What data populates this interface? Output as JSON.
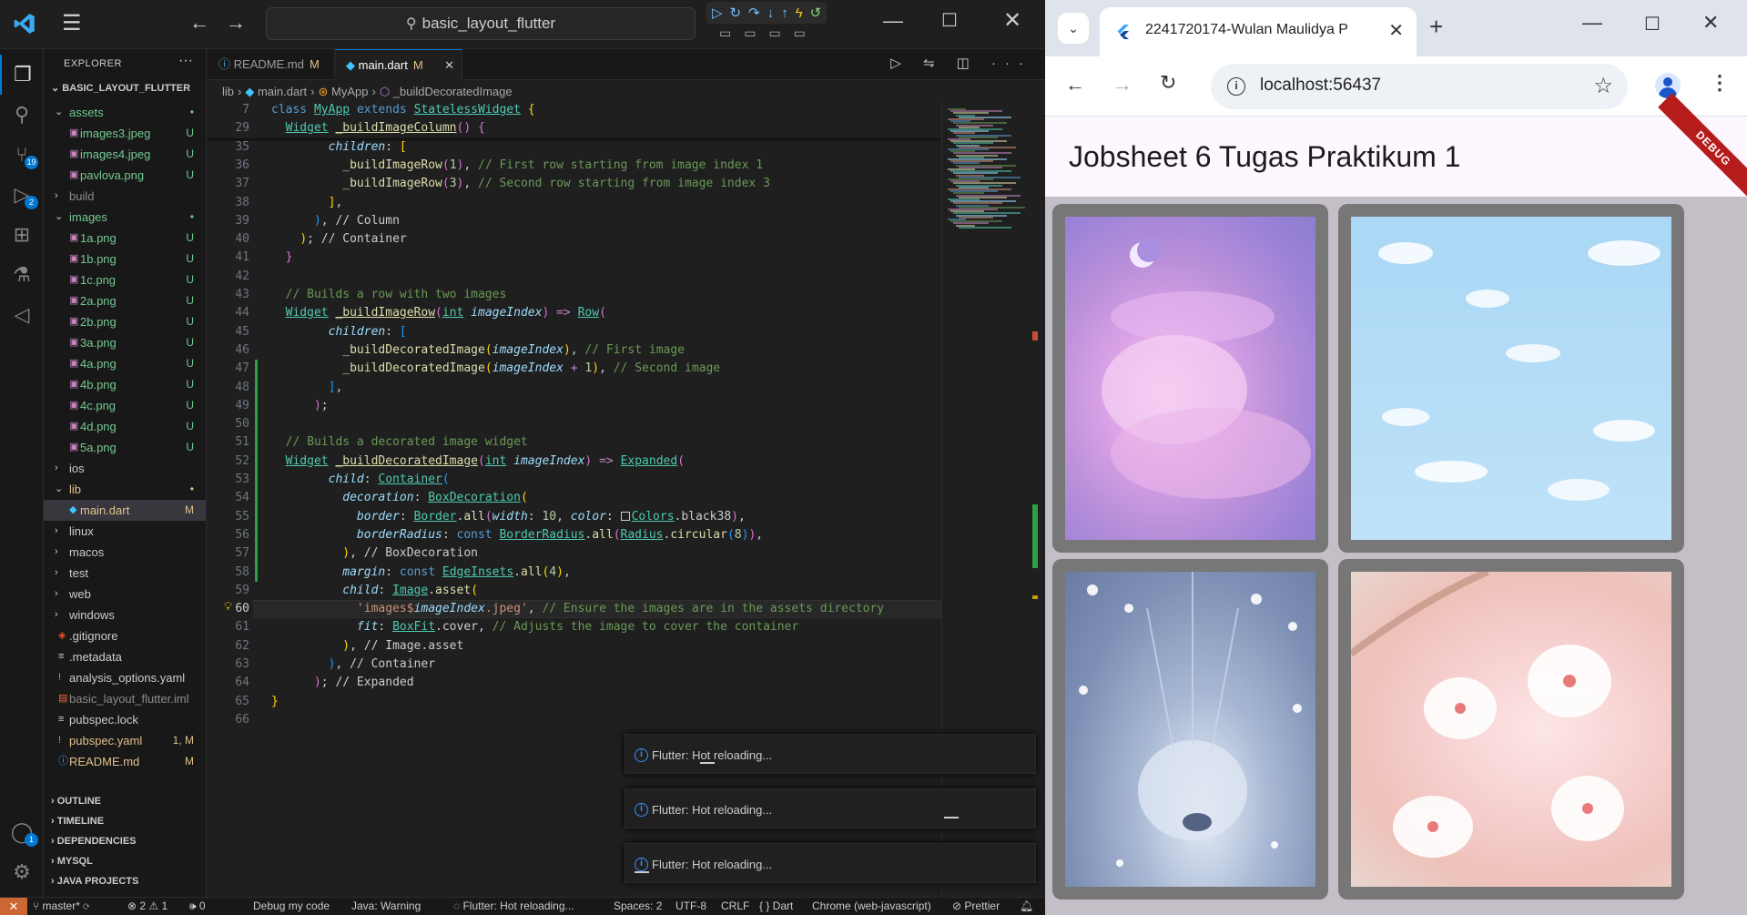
{
  "vscode": {
    "project_name": "basic_layout_flutter",
    "explorer": {
      "title": "EXPLORER",
      "more": "···",
      "project_title": "BASIC_LAYOUT_FLUTTER",
      "tree": [
        {
          "name": "assets",
          "kind": "folder",
          "depth": 0,
          "status": "•",
          "color": "#73c991"
        },
        {
          "name": "images3.jpeg",
          "kind": "image",
          "depth": 1,
          "status": "U",
          "color": "#73c991"
        },
        {
          "name": "images4.jpeg",
          "kind": "image",
          "depth": 1,
          "status": "U",
          "color": "#73c991"
        },
        {
          "name": "pavlova.png",
          "kind": "image",
          "depth": 1,
          "status": "U",
          "color": "#73c991"
        },
        {
          "name": "build",
          "kind": "folder-closed",
          "depth": 0,
          "status": "",
          "color": "#8c8c8c"
        },
        {
          "name": "images",
          "kind": "folder",
          "depth": 0,
          "status": "•",
          "color": "#73c991"
        },
        {
          "name": "1a.png",
          "kind": "image",
          "depth": 1,
          "status": "U",
          "color": "#73c991"
        },
        {
          "name": "1b.png",
          "kind": "image",
          "depth": 1,
          "status": "U",
          "color": "#73c991"
        },
        {
          "name": "1c.png",
          "kind": "image",
          "depth": 1,
          "status": "U",
          "color": "#73c991"
        },
        {
          "name": "2a.png",
          "kind": "image",
          "depth": 1,
          "status": "U",
          "color": "#73c991"
        },
        {
          "name": "2b.png",
          "kind": "image",
          "depth": 1,
          "status": "U",
          "color": "#73c991"
        },
        {
          "name": "3a.png",
          "kind": "image",
          "depth": 1,
          "status": "U",
          "color": "#73c991"
        },
        {
          "name": "4a.png",
          "kind": "image",
          "depth": 1,
          "status": "U",
          "color": "#73c991"
        },
        {
          "name": "4b.png",
          "kind": "image",
          "depth": 1,
          "status": "U",
          "color": "#73c991"
        },
        {
          "name": "4c.png",
          "kind": "image",
          "depth": 1,
          "status": "U",
          "color": "#73c991"
        },
        {
          "name": "4d.png",
          "kind": "image",
          "depth": 1,
          "status": "U",
          "color": "#73c991"
        },
        {
          "name": "5a.png",
          "kind": "image",
          "depth": 1,
          "status": "U",
          "color": "#73c991"
        },
        {
          "name": "ios",
          "kind": "folder-closed",
          "depth": 0,
          "status": "",
          "color": "#cccccc"
        },
        {
          "name": "lib",
          "kind": "folder",
          "depth": 0,
          "status": "•",
          "color": "#e2c08d"
        },
        {
          "name": "main.dart",
          "kind": "dart",
          "depth": 1,
          "status": "M",
          "color": "#e2c08d",
          "selected": true
        },
        {
          "name": "linux",
          "kind": "folder-closed",
          "depth": 0,
          "status": "",
          "color": "#cccccc"
        },
        {
          "name": "macos",
          "kind": "folder-closed",
          "depth": 0,
          "status": "",
          "color": "#cccccc"
        },
        {
          "name": "test",
          "kind": "folder-closed",
          "depth": 0,
          "status": "",
          "color": "#cccccc"
        },
        {
          "name": "web",
          "kind": "folder-closed",
          "depth": 0,
          "status": "",
          "color": "#cccccc"
        },
        {
          "name": "windows",
          "kind": "folder-closed",
          "depth": 0,
          "status": "",
          "color": "#cccccc"
        },
        {
          "name": ".gitignore",
          "kind": "git",
          "depth": 0,
          "status": "",
          "color": "#cccccc"
        },
        {
          "name": ".metadata",
          "kind": "text",
          "depth": 0,
          "status": "",
          "color": "#cccccc"
        },
        {
          "name": "analysis_options.yaml",
          "kind": "yaml",
          "depth": 0,
          "status": "",
          "color": "#cccccc"
        },
        {
          "name": "basic_layout_flutter.iml",
          "kind": "iml",
          "depth": 0,
          "status": "",
          "color": "#8c8c8c"
        },
        {
          "name": "pubspec.lock",
          "kind": "text",
          "depth": 0,
          "status": "",
          "color": "#cccccc"
        },
        {
          "name": "pubspec.yaml",
          "kind": "yaml",
          "depth": 0,
          "status": "1, M",
          "color": "#e2c08d"
        },
        {
          "name": "README.md",
          "kind": "info",
          "depth": 0,
          "status": "M",
          "color": "#e2c08d"
        }
      ],
      "sections": [
        "OUTLINE",
        "TIMELINE",
        "DEPENDENCIES",
        "MYSQL",
        "JAVA PROJECTS"
      ]
    },
    "tabs": [
      {
        "label": "README.md",
        "mod": "M",
        "active": false
      },
      {
        "label": "main.dart",
        "mod": "M",
        "active": true
      }
    ],
    "breadcrumb": [
      "lib",
      "main.dart",
      "MyApp",
      "_buildDecoratedImage"
    ],
    "sticky_lines": [
      {
        "n": "7",
        "html": "<span class='k'>class</span> <span class='ty ul'>MyApp</span> <span class='k'>extends</span> <span class='ty ul'>StatelessWidget</span> <span class='p1'>{</span>"
      },
      {
        "n": "29",
        "html": "  <span class='ty ul'>Widget</span> <span class='fn ul'>_buildImageColumn</span><span class='p2'>()</span> <span class='p2'>{</span>"
      }
    ],
    "code_lines": [
      {
        "n": "35",
        "html": "        <span class='pr it'>children</span>: <span class='p1'>[</span>"
      },
      {
        "n": "36",
        "html": "          <span class='fn'>_buildImageRow</span><span class='p2'>(</span><span class='num'>1</span><span class='p2'>)</span>, <span class='cm'>// First row starting from image index 1</span>"
      },
      {
        "n": "37",
        "html": "          <span class='fn'>_buildImageRow</span><span class='p2'>(</span><span class='num'>3</span><span class='p2'>)</span>, <span class='cm'>// Second row starting from image index 3</span>"
      },
      {
        "n": "38",
        "html": "        <span class='p1'>]</span>,"
      },
      {
        "n": "39",
        "html": "      <span class='p3'>)</span>, <span class='cl2'>// Column</span>"
      },
      {
        "n": "40",
        "html": "    <span class='p1'>)</span>; <span class='cl2'>// Container</span>"
      },
      {
        "n": "41",
        "html": "  <span class='p2'>}</span>"
      },
      {
        "n": "42",
        "html": ""
      },
      {
        "n": "43",
        "html": "  <span class='cm'>// Builds a row with two images</span>"
      },
      {
        "n": "44",
        "html": "  <span class='ty ul'>Widget</span> <span class='fn ul'>_buildImageRow</span><span class='p2'>(</span><span class='ty ul'>int</span> <span class='pm it'>imageIndex</span><span class='p2'>)</span> <span class='kw'>=&gt;</span> <span class='ty ul'>Row</span><span class='p2'>(</span>"
      },
      {
        "n": "45",
        "html": "        <span class='pr it'>children</span>: <span class='p3'>[</span>"
      },
      {
        "n": "46",
        "html": "          <span class='fn'>_buildDecoratedImage</span><span class='p1'>(</span><span class='pm it'>imageIndex</span><span class='p1'>)</span>, <span class='cm'>// First image</span>"
      },
      {
        "n": "47",
        "html": "          <span class='fn'>_buildDecoratedImage</span><span class='p1'>(</span><span class='pm it'>imageIndex</span> <span class='kw'>+</span> <span class='num'>1</span><span class='p1'>)</span>, <span class='cm'>// Second image</span>"
      },
      {
        "n": "48",
        "html": "        <span class='p3'>]</span>,"
      },
      {
        "n": "49",
        "html": "      <span class='p2'>)</span>;"
      },
      {
        "n": "50",
        "html": ""
      },
      {
        "n": "51",
        "html": "  <span class='cm'>// Builds a decorated image widget</span>"
      },
      {
        "n": "52",
        "html": "  <span class='ty ul'>Widget</span> <span class='fn ul'>_buildDecoratedImage</span><span class='p2'>(</span><span class='ty ul'>int</span> <span class='pm it'>imageIndex</span><span class='p2'>)</span> <span class='kw'>=&gt;</span> <span class='ty ul'>Expanded</span><span class='p2'>(</span>"
      },
      {
        "n": "53",
        "html": "        <span class='pr it'>child</span>: <span class='ty ul'>Container</span><span class='p3'>(</span>"
      },
      {
        "n": "54",
        "html": "          <span class='pr it'>decoration</span>: <span class='ty ul'>BoxDecoration</span><span class='p1'>(</span>"
      },
      {
        "n": "55",
        "html": "            <span class='pr it'>border</span>: <span class='ty ul'>Border</span>.<span class='fn'>all</span><span class='p2'>(</span><span class='pr it'>width</span>: <span class='num'>10</span>, <span class='pr it'>color</span>: <span class='sw'></span><span class='ty ul'>Colors</span>.black38<span class='p2'>)</span>,"
      },
      {
        "n": "56",
        "html": "            <span class='pr it'>borderRadius</span>: <span class='k'>const</span> <span class='ty ul'>BorderRadius</span>.<span class='fn'>all</span><span class='p2'>(</span><span class='ty ul'>Radius</span>.<span class='fn'>circular</span><span class='p3'>(</span><span class='num'>8</span><span class='p3'>)</span><span class='p2'>)</span>,"
      },
      {
        "n": "57",
        "html": "          <span class='p1'>)</span>, <span class='cl2'>// BoxDecoration</span>"
      },
      {
        "n": "58",
        "html": "          <span class='pr it'>margin</span>: <span class='k'>const</span> <span class='ty ul'>EdgeInsets</span>.<span class='fn'>all</span><span class='p1'>(</span><span class='num'>4</span><span class='p1'>)</span>,"
      },
      {
        "n": "59",
        "html": "          <span class='pr it'>child</span>: <span class='ty ul'>Image</span>.<span class='fn'>asset</span><span class='p1'>(</span>"
      },
      {
        "n": "60",
        "html": "            <span class='str'>'images$</span><span class='pm it'>imageIndex</span><span class='str'>.jpeg'</span>, <span class='cm'>// Ensure the images are in the assets directory</span>"
      },
      {
        "n": "61",
        "html": "            <span class='pr it'>fit</span>: <span class='ty ul'>BoxFit</span>.cover, <span class='cm'>// Adjusts the image to cover the container</span>"
      },
      {
        "n": "62",
        "html": "          <span class='p1'>)</span>, <span class='cl2'>// Image.asset</span>"
      },
      {
        "n": "63",
        "html": "        <span class='p3'>)</span>, <span class='cl2'>// Container</span>"
      },
      {
        "n": "64",
        "html": "      <span class='p2'>)</span>; <span class='cl2'>// Expanded</span>"
      },
      {
        "n": "65",
        "html": "<span class='p1'>}</span>"
      },
      {
        "n": "66",
        "html": ""
      }
    ],
    "current_line": "60",
    "toasts": [
      "Flutter: Hot reloading...",
      "Flutter: Hot reloading...",
      "Flutter: Hot reloading..."
    ],
    "statusbar": {
      "branch": "master*",
      "problems": "⊗ 2 ⚠ 1",
      "ports": "🕪 0",
      "debug": "Debug my code",
      "java": "Java: Warning",
      "flutter": "Flutter: Hot reloading...",
      "spaces": "Spaces: 2",
      "encoding": "UTF-8",
      "eol": "CRLF",
      "language": "{ } Dart",
      "device": "Chrome (web-javascript)",
      "prettier": "Prettier"
    },
    "activity_badges": {
      "scm": "19",
      "debug": "2",
      "accounts": "1"
    }
  },
  "chrome": {
    "tab_title": "2241720174-Wulan Maulidya P",
    "url": "localhost:56437",
    "app": {
      "title": "Jobsheet 6 Tugas Praktikum 1",
      "debug_banner": "DEBUG",
      "images": [
        {
          "name": "purple-sky-moon-image"
        },
        {
          "name": "blue-sky-clouds-image"
        },
        {
          "name": "crystal-chandelier-image"
        },
        {
          "name": "cherry-blossom-image"
        }
      ]
    }
  },
  "colors": {
    "accent": "#0078d4",
    "modified": "#e2c08d",
    "untracked": "#73c991",
    "remote": "#cc6633",
    "app_bar": "#fdf7ff"
  }
}
